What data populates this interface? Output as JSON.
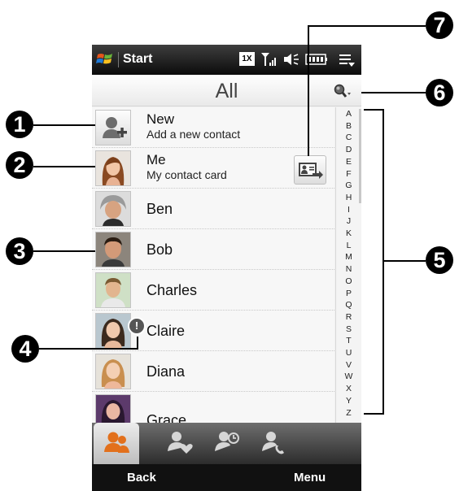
{
  "status_bar": {
    "start_label": "Start",
    "network_label": "1X",
    "icons": [
      "windows-logo",
      "signal-icon",
      "speaker-mute-icon",
      "battery-icon",
      "menu-dropdown-icon"
    ]
  },
  "header": {
    "title": "All",
    "search_icon": "magnifier-with-dropdown"
  },
  "contacts": [
    {
      "name": "New",
      "subtitle": "Add a new contact",
      "icon": "add-contact-icon"
    },
    {
      "name": "Me",
      "subtitle": "My contact card",
      "icon": "contact-card-send-icon"
    },
    {
      "name": "Ben"
    },
    {
      "name": "Bob"
    },
    {
      "name": "Charles"
    },
    {
      "name": "Claire",
      "icon": "alert-icon",
      "alert_mark": "!"
    },
    {
      "name": "Diana"
    },
    {
      "name": "Grace"
    }
  ],
  "alphabet": [
    "A",
    "B",
    "C",
    "D",
    "E",
    "F",
    "G",
    "H",
    "I",
    "J",
    "K",
    "L",
    "M",
    "N",
    "O",
    "P",
    "Q",
    "R",
    "S",
    "T",
    "U",
    "V",
    "W",
    "X",
    "Y",
    "Z"
  ],
  "tabs": [
    "people-tab",
    "favorites-tab",
    "recent-tab",
    "call-history-tab"
  ],
  "softkeys": {
    "left": "Back",
    "right": "Menu"
  },
  "callouts": [
    "1",
    "2",
    "3",
    "4",
    "5",
    "6",
    "7"
  ],
  "colors": {
    "accent": "#e2701c",
    "statusbar": "#1a1a1a"
  }
}
